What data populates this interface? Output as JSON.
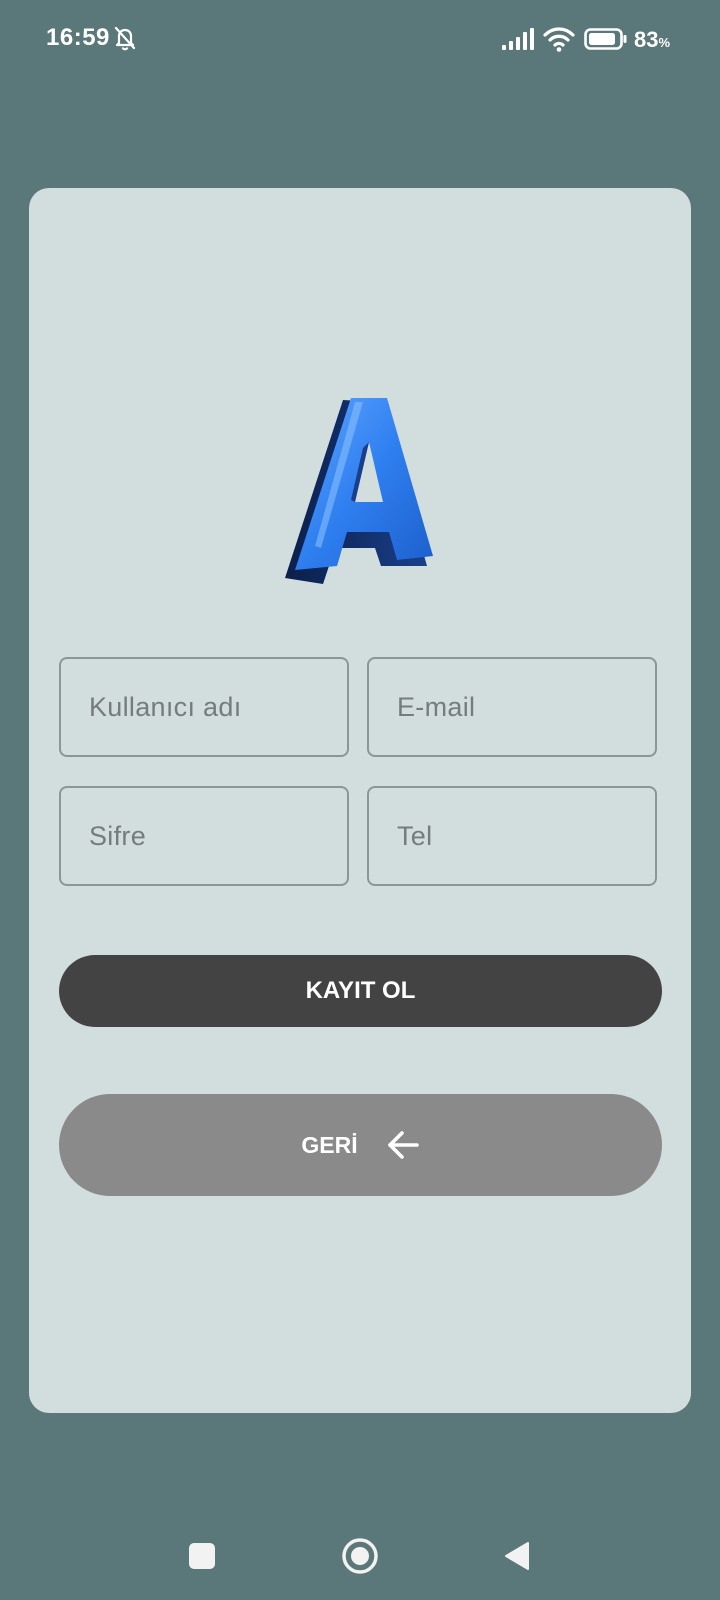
{
  "status_bar": {
    "time": "16:59",
    "battery_value": "83",
    "battery_unit": "%",
    "icons": [
      "bell-off-icon",
      "signal-icon",
      "wifi-icon",
      "battery-icon"
    ]
  },
  "logo": {
    "letter": "A",
    "color": "#2f7ff0"
  },
  "form": {
    "username_placeholder": "Kullanıcı adı",
    "email_placeholder": "E-mail",
    "password_placeholder": "Sifre",
    "phone_placeholder": "Tel"
  },
  "buttons": {
    "register_label": "KAYIT OL",
    "back_label": "GERİ",
    "back_icon": "arrow-left-icon"
  },
  "nav_bar": {
    "icons": [
      "recents-square-icon",
      "home-circle-icon",
      "back-triangle-icon"
    ]
  },
  "colors": {
    "background": "#5a7779",
    "card": "#d2dddd",
    "register_button": "#434343",
    "back_button": "#8a8a8a"
  }
}
